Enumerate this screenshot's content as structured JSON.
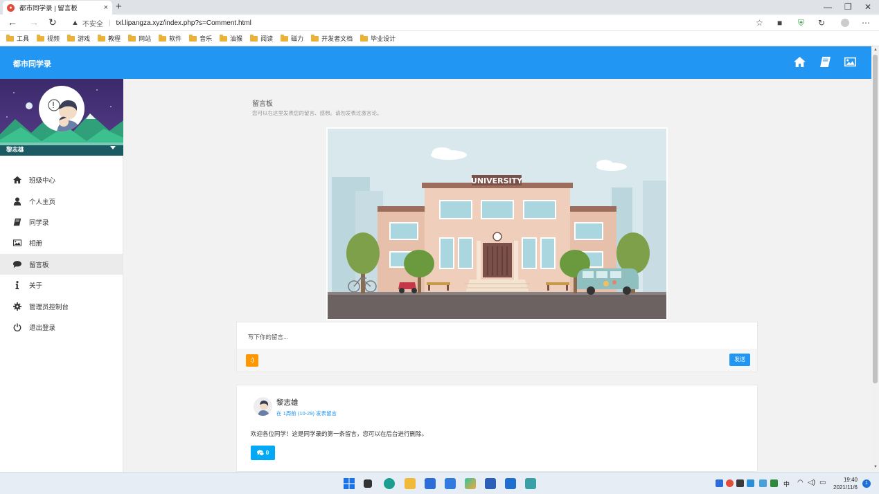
{
  "browser": {
    "tab_title": "都市同学录 | 留言板",
    "tab_close": "×",
    "new_tab": "+",
    "security_label": "不安全",
    "url": "txl.lipangza.xyz/index.php?s=Comment.html",
    "bookmarks": [
      "工具",
      "视频",
      "游戏",
      "教程",
      "网站",
      "软件",
      "音乐",
      "油猴",
      "阅读",
      "磁力",
      "开发者文档",
      "毕业设计"
    ]
  },
  "site": {
    "title": "都市同学录",
    "header_icons": [
      "home-icon",
      "book-icon",
      "image-icon"
    ],
    "accent": "#2196f3"
  },
  "sidebar": {
    "user_name": "黎志雄",
    "items": [
      {
        "label": "班级中心",
        "icon": "home-icon"
      },
      {
        "label": "个人主页",
        "icon": "user-icon"
      },
      {
        "label": "同学录",
        "icon": "book-icon"
      },
      {
        "label": "相册",
        "icon": "image-icon"
      },
      {
        "label": "留言板",
        "icon": "comment-icon",
        "active": true
      },
      {
        "label": "关于",
        "icon": "info-icon"
      },
      {
        "label": "管理员控制台",
        "icon": "gear-icon"
      },
      {
        "label": "退出登录",
        "icon": "power-icon"
      }
    ]
  },
  "main": {
    "title": "留言板",
    "subtitle": "您可以在这里发表您的留言、感想。请勿发表过激言论。",
    "hero_sign": "UNIVERSITY",
    "composer": {
      "placeholder": "写下你的留言...",
      "emoji_label": ":)",
      "send_label": "发送"
    },
    "comments": [
      {
        "author": "黎志雄",
        "meta": "在 1周前 (10-29) 发表留言",
        "text": "欢迎各位同学！这是同学录的第一条留言，您可以在后台进行删除。",
        "reply_count": "0"
      }
    ]
  },
  "taskbar": {
    "ime": "中",
    "time": "19:40",
    "date": "2021/11/6",
    "notifications": "1"
  }
}
